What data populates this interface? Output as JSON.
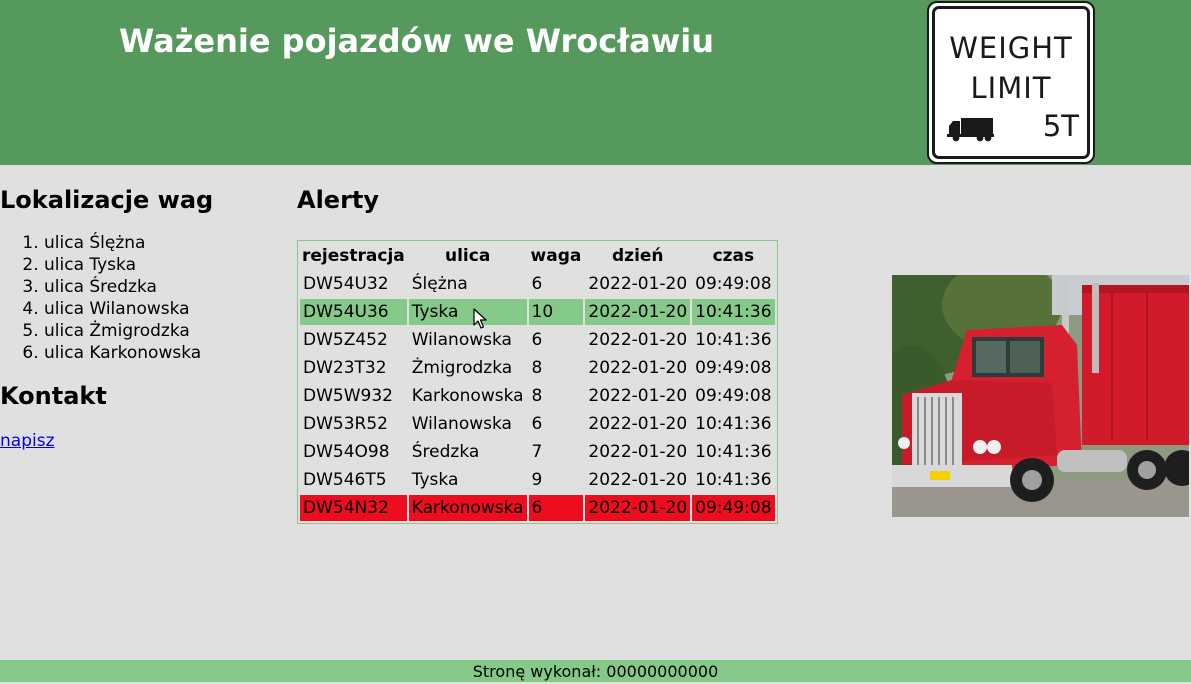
{
  "header": {
    "title": "Ważenie pojazdów we Wrocławiu",
    "sign": {
      "line1": "WEIGHT",
      "line2": "LIMIT",
      "limit": "5T",
      "icon": "truck-icon"
    }
  },
  "sidebar": {
    "locations_title": "Lokalizacje wag",
    "locations": [
      "ulica Ślężna",
      "ulica Tyska",
      "ulica Średzka",
      "ulica Wilanowska",
      "ulica Żmigrodzka",
      "ulica Karkonowska"
    ],
    "contact_title": "Kontakt",
    "contact_link": "napisz"
  },
  "alerts": {
    "title": "Alerty",
    "columns": [
      "rejestracja",
      "ulica",
      "waga",
      "dzień",
      "czas"
    ],
    "rows": [
      [
        "DW54U32",
        "Ślężna",
        "6",
        "2022-01-20",
        "09:49:08"
      ],
      [
        "DW54U36",
        "Tyska",
        "10",
        "2022-01-20",
        "10:41:36"
      ],
      [
        "DW5Z452",
        "Wilanowska",
        "6",
        "2022-01-20",
        "10:41:36"
      ],
      [
        "DW23T32",
        "Żmigrodzka",
        "8",
        "2022-01-20",
        "09:49:08"
      ],
      [
        "DW5W932",
        "Karkonowska",
        "8",
        "2022-01-20",
        "09:49:08"
      ],
      [
        "DW53R52",
        "Wilanowska",
        "6",
        "2022-01-20",
        "10:41:36"
      ],
      [
        "DW54O98",
        "Średzka",
        "7",
        "2022-01-20",
        "10:41:36"
      ],
      [
        "DW546T5",
        "Tyska",
        "9",
        "2022-01-20",
        "10:41:36"
      ],
      [
        "DW54N32",
        "Karkonowska",
        "6",
        "2022-01-20",
        "09:49:08"
      ]
    ],
    "highlight_green_row": 1,
    "highlight_red_row": 8,
    "colors": {
      "green_highlight": "#84c988",
      "red_highlight": "#ee0d1e"
    }
  },
  "photo": {
    "icon": "red-truck-photo"
  },
  "footer": {
    "text": "Stronę wykonał: 00000000000"
  },
  "colors": {
    "header_bg": "#56995c",
    "page_bg": "#e0e0e0",
    "footer_bg": "#84c988",
    "title_text": "#ffffff",
    "link": "#0000ee"
  }
}
